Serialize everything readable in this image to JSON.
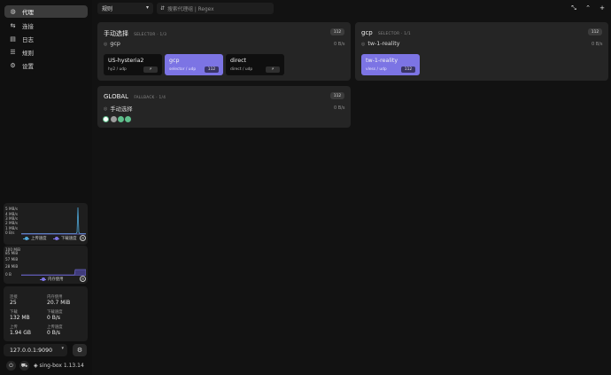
{
  "sidebar": {
    "items": [
      {
        "label": "代理",
        "icon": "globe-icon",
        "active": true
      },
      {
        "label": "连接",
        "icon": "link-icon",
        "active": false
      },
      {
        "label": "日志",
        "icon": "document-icon",
        "active": false
      },
      {
        "label": "规则",
        "icon": "rules-icon",
        "active": false
      },
      {
        "label": "设置",
        "icon": "gear-icon",
        "active": false
      }
    ]
  },
  "traffic_chart": {
    "y_ticks": [
      "5 MB/s",
      "4 MB/s",
      "3 MB/s",
      "2 MB/s",
      "1 MB/s",
      "0 B/s"
    ],
    "legend": {
      "upload": "上传速度",
      "download": "下载速度"
    },
    "colors": {
      "upload": "#4fa7d8",
      "download": "#7c74e4"
    }
  },
  "memory_chart": {
    "y_ticks": [
      "100 MiB",
      "85 MiB",
      "57 MiB",
      "28 MiB",
      "0 B"
    ],
    "legend": "内存使用"
  },
  "stats": {
    "connections": {
      "label": "连接",
      "value": "25"
    },
    "memory": {
      "label": "内存使用",
      "value": "20.7 MiB"
    },
    "download": {
      "label": "下载",
      "value": "132 MB"
    },
    "download_speed": {
      "label": "下载速度",
      "value": "0 B/s"
    },
    "upload": {
      "label": "上传",
      "value": "1.94 GB"
    },
    "upload_speed": {
      "label": "上传速度",
      "value": "0 B/s"
    }
  },
  "backend": {
    "address": "127.0.0.1:9090",
    "version": "sing-box 1.13.14"
  },
  "topbar": {
    "mode": "规则",
    "search_placeholder": "搜索代理组 | Regex"
  },
  "groups": {
    "manual": {
      "title": "手动选择",
      "type": "SELECTOR",
      "count": "1/3",
      "badge": "112",
      "selected": "gcp",
      "speed": "0 B/s",
      "nodes": [
        {
          "name": "US-hysteria2",
          "type": "hy2 / udp",
          "tag": "⚡"
        },
        {
          "name": "gcp",
          "type": "selector / udp",
          "tag": "112"
        },
        {
          "name": "direct",
          "type": "direct / udp",
          "tag": "⚡"
        }
      ]
    },
    "gcp": {
      "title": "gcp",
      "type": "SELECTOR",
      "count": "1/1",
      "badge": "112",
      "selected": "tw-1-reality",
      "speed": "0 B/s",
      "nodes": [
        {
          "name": "tw-1-reality",
          "type": "vless / udp",
          "tag": "112"
        }
      ]
    },
    "global": {
      "title": "GLOBAL",
      "type": "FALLBACK",
      "count": "1/4",
      "badge": "112",
      "selected": "手动选择",
      "speed": "0 B/s"
    }
  }
}
